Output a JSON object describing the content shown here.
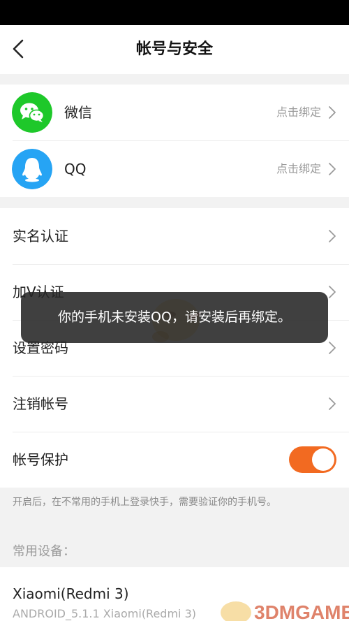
{
  "header": {
    "title": "帐号与安全"
  },
  "bind_section": {
    "wechat": {
      "label": "微信",
      "hint": "点击绑定",
      "icon": "wechat-icon",
      "color": "#1ec82a"
    },
    "qq": {
      "label": "QQ",
      "hint": "点击绑定",
      "icon": "qq-penguin-icon",
      "color": "#26a4f4"
    }
  },
  "settings": {
    "real_name": "实名认证",
    "v_verify": "加V认证",
    "set_password": "设置密码",
    "cancel_account": "注销帐号",
    "account_protect": {
      "label": "帐号保护",
      "enabled": true,
      "color": "#f26a21"
    }
  },
  "protect_desc": "开启后，在不常用的手机上登录快手，需要验证你的手机号。",
  "devices": {
    "title": "常用设备：",
    "items": [
      {
        "name": "Xiaomi(Redmi 3)",
        "sub": "ANDROID_5.1.1 Xiaomi(Redmi 3)"
      }
    ]
  },
  "toast": {
    "message": "你的手机未安装QQ，请安装后再绑定。"
  },
  "watermark": {
    "text": "3DMGAME"
  }
}
